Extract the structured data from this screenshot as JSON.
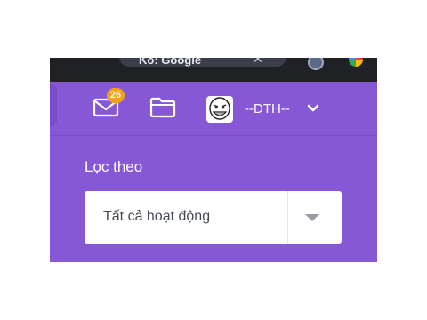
{
  "browser": {
    "tab_title": "Ko: Google",
    "close_icon": "close-icon"
  },
  "header": {
    "mail": {
      "icon": "mail-icon",
      "badge_count": "26",
      "badge_color": "#f2a10f"
    },
    "folder": {
      "icon": "folder-icon"
    },
    "user": {
      "avatar": "troll-face-avatar",
      "name": "--DTH--",
      "menu_icon": "chevron-down-icon"
    }
  },
  "filter": {
    "label": "Lọc theo",
    "selected": "Tất cả hoạt động",
    "dropdown_icon": "caret-down-icon"
  },
  "colors": {
    "panel": "#8758d6",
    "browser_bar": "#202124",
    "select_bg": "#ffffff"
  }
}
